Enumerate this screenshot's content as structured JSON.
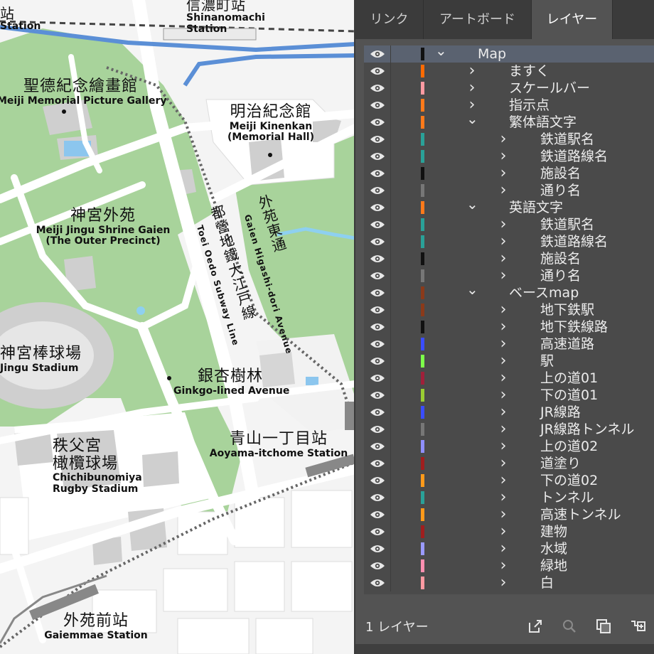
{
  "tabs": [
    {
      "label": "リンク"
    },
    {
      "label": "アートボード"
    },
    {
      "label": "レイヤー"
    }
  ],
  "layers": [
    {
      "name": "Map",
      "color": "#111111",
      "expanded": true,
      "indent": 0,
      "selected": true
    },
    {
      "name": "ますく",
      "color": "#ff6a00",
      "expanded": false,
      "indent": 1
    },
    {
      "name": "スケールバー",
      "color": "#ff9aa2",
      "expanded": false,
      "indent": 1
    },
    {
      "name": "指示点",
      "color": "#ff7a1a",
      "expanded": false,
      "indent": 1
    },
    {
      "name": "繁体語文字",
      "color": "#ff7a1a",
      "expanded": true,
      "indent": 1
    },
    {
      "name": "鉄道駅名",
      "color": "#2aa198",
      "expanded": false,
      "indent": 2
    },
    {
      "name": "鉄道路線名",
      "color": "#2aa198",
      "expanded": false,
      "indent": 2
    },
    {
      "name": "施設名",
      "color": "#111111",
      "expanded": false,
      "indent": 2
    },
    {
      "name": "通り名",
      "color": "#777777",
      "expanded": false,
      "indent": 2
    },
    {
      "name": "英語文字",
      "color": "#ff7a1a",
      "expanded": true,
      "indent": 1
    },
    {
      "name": "鉄道駅名",
      "color": "#2aa198",
      "expanded": false,
      "indent": 2
    },
    {
      "name": "鉄道路線名",
      "color": "#2aa198",
      "expanded": false,
      "indent": 2
    },
    {
      "name": "施設名",
      "color": "#111111",
      "expanded": false,
      "indent": 2
    },
    {
      "name": "通り名",
      "color": "#777777",
      "expanded": false,
      "indent": 2
    },
    {
      "name": "ベースmap",
      "color": "#8b3a1a",
      "expanded": true,
      "indent": 1
    },
    {
      "name": "地下鉄駅",
      "color": "#8b3a1a",
      "expanded": false,
      "indent": 2
    },
    {
      "name": "地下鉄線路",
      "color": "#111111",
      "expanded": false,
      "indent": 2
    },
    {
      "name": "高速道路",
      "color": "#3a4dff",
      "expanded": false,
      "indent": 2
    },
    {
      "name": "駅",
      "color": "#7dff4a",
      "expanded": false,
      "indent": 2
    },
    {
      "name": "上の道01",
      "color": "#a0203a",
      "expanded": false,
      "indent": 2
    },
    {
      "name": "下の道01",
      "color": "#9acd32",
      "expanded": false,
      "indent": 2
    },
    {
      "name": "JR線路",
      "color": "#3a4dff",
      "expanded": false,
      "indent": 2
    },
    {
      "name": "JR線路トンネル",
      "color": "#777777",
      "expanded": false,
      "indent": 2
    },
    {
      "name": "上の道02",
      "color": "#8f8fff",
      "expanded": false,
      "indent": 2
    },
    {
      "name": "道塗り",
      "color": "#a01e1e",
      "expanded": false,
      "indent": 2
    },
    {
      "name": "下の道02",
      "color": "#ff9a1a",
      "expanded": false,
      "indent": 2
    },
    {
      "name": "トンネル",
      "color": "#2aa198",
      "expanded": false,
      "indent": 2
    },
    {
      "name": "高速トンネル",
      "color": "#ff9a1a",
      "expanded": false,
      "indent": 2
    },
    {
      "name": "建物",
      "color": "#a01e1e",
      "expanded": false,
      "indent": 2
    },
    {
      "name": "水域",
      "color": "#9a9aff",
      "expanded": false,
      "indent": 2
    },
    {
      "name": "緑地",
      "color": "#ff8fb0",
      "expanded": false,
      "indent": 2
    },
    {
      "name": "白",
      "color": "#ff9aa2",
      "expanded": false,
      "indent": 2
    }
  ],
  "footer": {
    "layer_count": "1 レイヤー"
  },
  "footer_icons": [
    "export-icon",
    "search-icon",
    "clipping-mask-icon",
    "new-sublayer-icon"
  ],
  "map": {
    "shinanomachi": {
      "ja": "信濃町站",
      "en": "Shinanomachi Station"
    },
    "top_left_station": {
      "ja": "站",
      "en": "Station"
    },
    "gallery": {
      "ja": "聖德紀念繪畫館",
      "en": "Meiji Memorial Picture Gallery"
    },
    "kinenkan": {
      "ja": "明治紀念館",
      "en1": "Meiji Kinenkan",
      "en2": "(Memorial Hall)"
    },
    "gaien": {
      "ja": "神宮外苑",
      "en1": "Meiji Jingu Shrine Gaien",
      "en2": "(The Outer Precinct)"
    },
    "stadium": {
      "ja": "神宮棒球場",
      "en": "Jingu Stadium"
    },
    "ginkgo": {
      "ja": "銀杏樹林",
      "en": "Ginkgo-lined Avenue"
    },
    "aoyama": {
      "ja": "青山一丁目站",
      "en": "Aoyama-itchome  Station"
    },
    "chichibu": {
      "ja1": "秩父宮",
      "ja2": "橄欖球場",
      "en1": "Chichibunomiya",
      "en2": "Rugby Stadium"
    },
    "gaiemmae": {
      "ja": "外苑前站",
      "en": "Gaiemmae Station"
    },
    "oedo": {
      "ja": "都營地鐵大江戸線",
      "en": "Toei Oedo Subway Line"
    },
    "higashi": {
      "ja": "外苑東通",
      "en": "Gaien Higashi-dori Avenue"
    }
  },
  "colors": {
    "green": "#a8d39b",
    "road": "#ffffff",
    "bg": "#f4f4f4",
    "building": "#d3d3d3",
    "jr": "#5b8fd6",
    "panel": "#535353"
  }
}
